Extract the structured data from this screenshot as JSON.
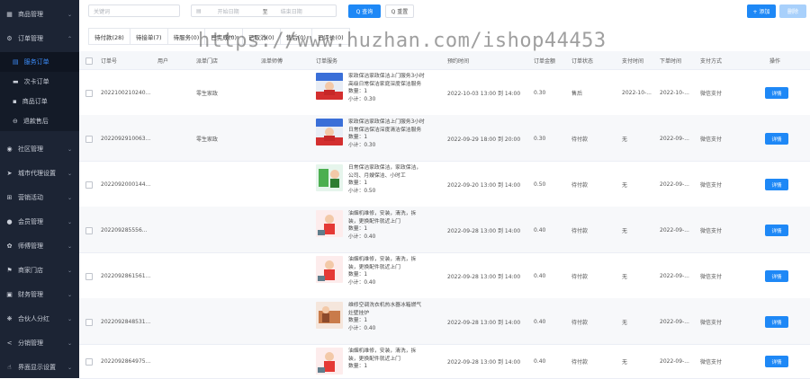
{
  "sidebar": {
    "items": [
      {
        "label": "商品管理",
        "icon": "grid-icon",
        "glyph": "▦"
      },
      {
        "label": "订单管理",
        "icon": "gear-icon",
        "glyph": "⚙"
      },
      {
        "label": "社区管理",
        "icon": "chat-icon",
        "glyph": "◉"
      },
      {
        "label": "城市代理设置",
        "icon": "send-icon",
        "glyph": "➤"
      },
      {
        "label": "营销活动",
        "icon": "building-icon",
        "glyph": "⊞"
      },
      {
        "label": "会员管理",
        "icon": "user-icon",
        "glyph": "●"
      },
      {
        "label": "师傅管理",
        "icon": "settings-icon",
        "glyph": "✿"
      },
      {
        "label": "商家门店",
        "icon": "flag-icon",
        "glyph": "⚑"
      },
      {
        "label": "财务管理",
        "icon": "wallet-icon",
        "glyph": "▣"
      },
      {
        "label": "合伙人分红",
        "icon": "flower-icon",
        "glyph": "❋"
      },
      {
        "label": "分销管理",
        "icon": "share-icon",
        "glyph": "<"
      },
      {
        "label": "界面显示设置",
        "icon": "hand-icon",
        "glyph": "☝"
      }
    ],
    "submenu": [
      {
        "label": "服务订单",
        "icon": "calendar-icon",
        "glyph": "▤"
      },
      {
        "label": "次卡订单",
        "icon": "card-icon",
        "glyph": "▬"
      },
      {
        "label": "商品订单",
        "icon": "bag-icon",
        "glyph": "▪"
      },
      {
        "label": "退款售后",
        "icon": "refund-icon",
        "glyph": "⊖"
      }
    ]
  },
  "search": {
    "keyword_placeholder": "关键词",
    "start_placeholder": "开始日期",
    "range_sep": "至",
    "end_placeholder": "结束日期",
    "query_label": "Q 查询",
    "reset_label": "Q 重置",
    "add_label": "+ 添加",
    "delete_label": "删除"
  },
  "tabs": [
    "待付款(28)",
    "待接单(7)",
    "待服务(0)",
    "已完成(0)",
    "已取消(0)",
    "售后(0)",
    "已评价(0)"
  ],
  "watermark": "https://www.huzhan.com/ishop44453",
  "table": {
    "headers": [
      "订单号",
      "用户",
      "派单门店",
      "派单师傅",
      "订单服务",
      "预约时间",
      "订单金额",
      "订单状态",
      "支付时间",
      "下单时间",
      "支付方式",
      "操作"
    ],
    "rows": [
      {
        "order_no": "2022100210240...",
        "user": "",
        "store": "零生家政",
        "master": "",
        "svc": [
          "家政保洁家政保洁上门服务3小时",
          "高级日常保洁家庭深度保洁服务"
        ],
        "qty": "数量：1",
        "subtotal": "小计：0.30",
        "time": "2022-10-03 13:00 到 14:00",
        "amount": "0.30",
        "status": "售后",
        "pay_time": "2022-10-...",
        "order_time": "2022-10-...",
        "pay_method": "微信支付",
        "action": "详情",
        "thumb": "cleaning"
      },
      {
        "order_no": "2022092910063...",
        "user": "",
        "store": "零生家政",
        "master": "",
        "svc": [
          "家政保洁家政保洁上门服务3小时",
          "日常保洁保洁深度清洁保洁服务"
        ],
        "qty": "数量：1",
        "subtotal": "小计：0.30",
        "time": "2022-09-29 18:00 到 20:00",
        "amount": "0.30",
        "status": "待付款",
        "pay_time": "无",
        "order_time": "2022-09-...",
        "pay_method": "微信支付",
        "action": "详情",
        "thumb": "cleaning"
      },
      {
        "order_no": "2022092000144...",
        "user": "",
        "store": "",
        "master": "",
        "svc": [
          "日常保洁家政保洁，家政保洁，",
          "公司、月嫂保洁、小时工"
        ],
        "qty": "数量：1",
        "subtotal": "小计：0.50",
        "time": "2022-09-20 13:00 到 14:00",
        "amount": "0.50",
        "status": "待付款",
        "pay_time": "无",
        "order_time": "2022-09-...",
        "pay_method": "微信支付",
        "action": "详情",
        "thumb": "green"
      },
      {
        "order_no": "202209285556...",
        "user": "",
        "store": "",
        "master": "",
        "svc": [
          "油烟机维修，安装，清洗，拆",
          "装，更换配件就近上门"
        ],
        "qty": "数量：1",
        "subtotal": "小计：0.40",
        "time": "2022-09-28 13:00 到 14:00",
        "amount": "0.40",
        "status": "待付款",
        "pay_time": "无",
        "order_time": "2022-09-...",
        "pay_method": "微信支付",
        "action": "详情",
        "thumb": "worker"
      },
      {
        "order_no": "2022092861561...",
        "user": "",
        "store": "",
        "master": "",
        "svc": [
          "油烟机维修，安装，清洗，拆",
          "装，更换配件就近上门"
        ],
        "qty": "数量：1",
        "subtotal": "小计：0.40",
        "time": "2022-09-28 13:00 到 14:00",
        "amount": "0.40",
        "status": "待付款",
        "pay_time": "无",
        "order_time": "2022-09-...",
        "pay_method": "微信支付",
        "action": "详情",
        "thumb": "worker"
      },
      {
        "order_no": "2022092848531...",
        "user": "",
        "store": "",
        "master": "",
        "svc": [
          "维修空调洗衣机热水器冰箱燃气",
          "灶壁挂炉"
        ],
        "qty": "数量：1",
        "subtotal": "小计：0.40",
        "time": "2022-09-28 13:00 到 14:00",
        "amount": "0.40",
        "status": "待付款",
        "pay_time": "无",
        "order_time": "2022-09-...",
        "pay_method": "微信支付",
        "action": "详情",
        "thumb": "repair"
      },
      {
        "order_no": "2022092864975...",
        "user": "",
        "store": "",
        "master": "",
        "svc": [
          "油烟机维修，安装，清洗，拆",
          "装，更换配件就近上门"
        ],
        "qty": "数量：1",
        "subtotal": "",
        "time": "2022-09-28 13:00 到 14:00",
        "amount": "0.40",
        "status": "待付款",
        "pay_time": "无",
        "order_time": "2022-09-...",
        "pay_method": "微信支付",
        "action": "详情",
        "thumb": "worker"
      }
    ]
  },
  "colors": {
    "sidebar_bg": "#1c2434",
    "accent": "#1e88f6"
  }
}
